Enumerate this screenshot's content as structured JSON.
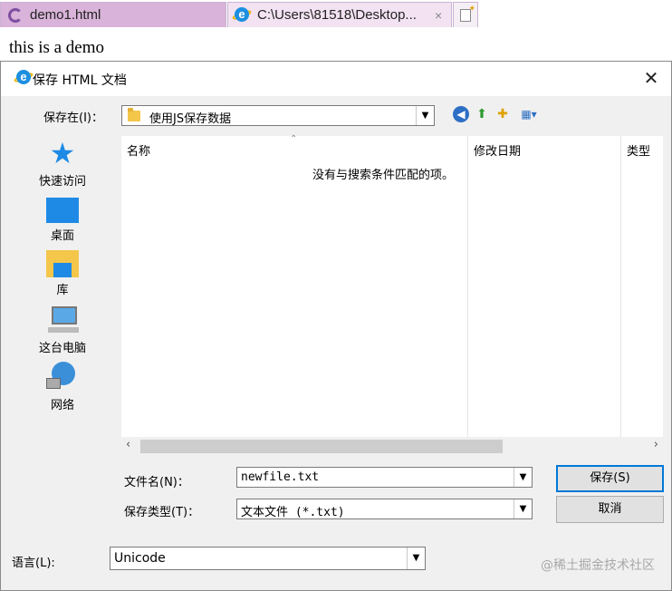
{
  "browser": {
    "tabs": [
      {
        "label": "demo1.html"
      },
      {
        "label": "C:\\Users\\81518\\Desktop..."
      }
    ],
    "tab_close": "×"
  },
  "page": {
    "text": "this is a demo"
  },
  "dialog": {
    "title": "保存 HTML 文档",
    "close": "✕",
    "save_in_label": "保存在(I)：",
    "save_in_value": "使用JS保存数据",
    "places": [
      {
        "label": "快速访问"
      },
      {
        "label": "桌面"
      },
      {
        "label": "库"
      },
      {
        "label": "这台电脑"
      },
      {
        "label": "网络"
      }
    ],
    "columns": [
      "名称",
      "修改日期",
      "类型"
    ],
    "empty_message": "没有与搜索条件匹配的项。",
    "filename_label": "文件名(N)：",
    "filename_value": "newfile.txt",
    "filetype_label": "保存类型(T)：",
    "filetype_value": "文本文件 (*.txt)",
    "save_button": "保存(S)",
    "cancel_button": "取消",
    "language_label": "语言(L):",
    "language_value": "Unicode"
  },
  "watermark": "@稀土掘金技术社区",
  "colors": {
    "accent": "#0078d7",
    "tab_active": "#d9b3d9"
  }
}
